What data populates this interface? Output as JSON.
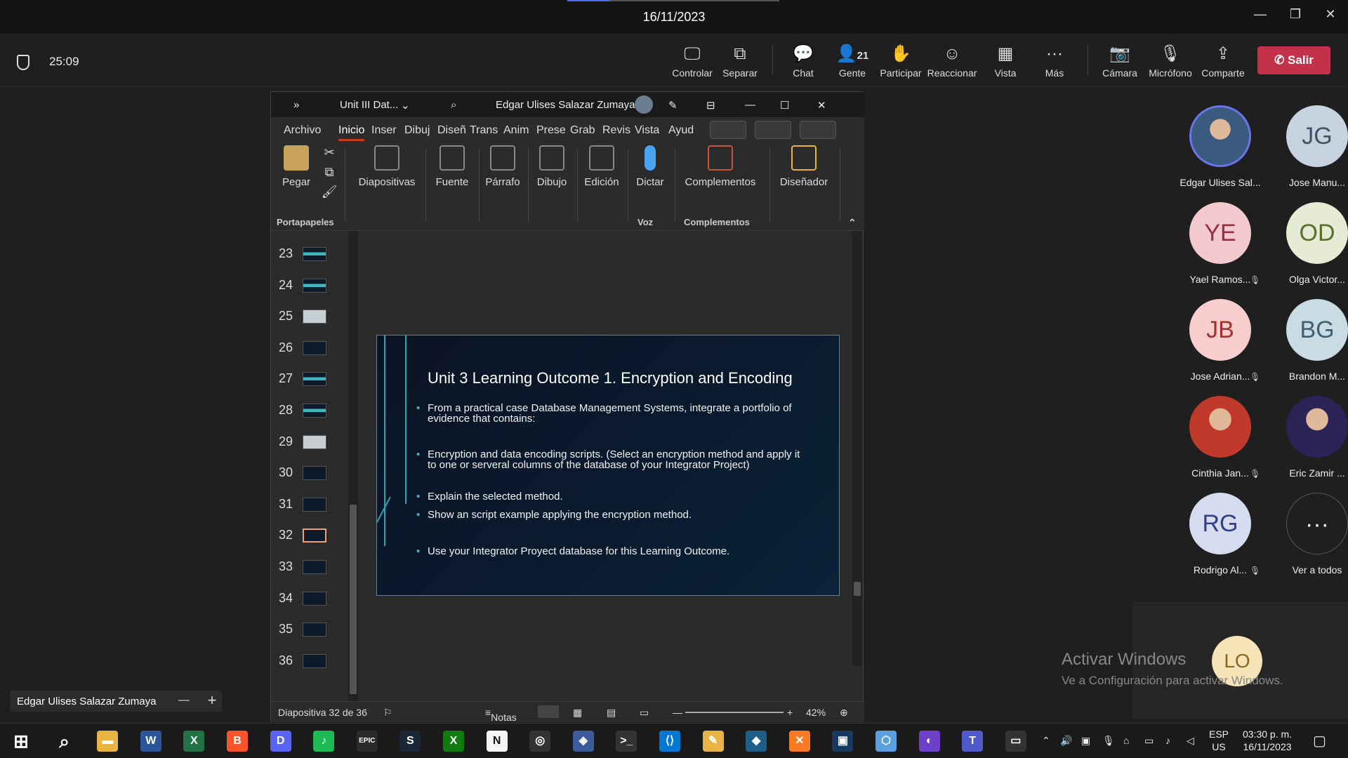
{
  "titlebar": {
    "date": "16/11/2023"
  },
  "meeting": {
    "timer": "25:09",
    "toolbar": [
      {
        "id": "controlar",
        "label": "Controlar",
        "icon": "control-icon",
        "glyph": "🖵"
      },
      {
        "id": "separar",
        "label": "Separar",
        "icon": "popout-icon",
        "glyph": "⧉"
      },
      {
        "id": "chat",
        "label": "Chat",
        "icon": "chat-icon",
        "glyph": "💬"
      },
      {
        "id": "gente",
        "label": "Gente",
        "icon": "people-icon",
        "glyph": "👤",
        "count": "21"
      },
      {
        "id": "participar",
        "label": "Participar",
        "icon": "raise-hand-icon",
        "glyph": "✋"
      },
      {
        "id": "reaccionar",
        "label": "Reaccionar",
        "icon": "react-icon",
        "glyph": "☺"
      },
      {
        "id": "vista",
        "label": "Vista",
        "icon": "view-icon",
        "glyph": "▦"
      },
      {
        "id": "mas",
        "label": "Más",
        "icon": "more-icon",
        "glyph": "···"
      },
      {
        "id": "camara",
        "label": "Cámara",
        "icon": "camera-off-icon",
        "glyph": "📷"
      },
      {
        "id": "microfono",
        "label": "Micrófono",
        "icon": "mic-off-icon",
        "glyph": "🎙"
      },
      {
        "id": "comparte",
        "label": "Comparte",
        "icon": "share-icon",
        "glyph": "⇪"
      }
    ],
    "leave_label": "Salir"
  },
  "ppt": {
    "file_name": "Unit III Dat...",
    "user_name": "Edgar Ulises Salazar Zumaya",
    "tabs": [
      "Archivo",
      "Inicio",
      "Inser",
      "Dibuj",
      "Diseñ",
      "Trans",
      "Anim",
      "Prese",
      "Grab",
      "Revis",
      "Vista",
      "Ayud"
    ],
    "active_tab": "Inicio",
    "ribbon": {
      "pegar": "Pegar",
      "diapositivas": "Diapositivas",
      "fuente": "Fuente",
      "parrafo": "Párrafo",
      "dibujo": "Dibujo",
      "edicion": "Edición",
      "dictar": "Dictar",
      "complementos": "Complementos",
      "disenador": "Diseñador",
      "group_portapapeles": "Portapapeles",
      "group_voz": "Voz",
      "group_complementos": "Complementos"
    },
    "thumbnails": [
      {
        "num": "23",
        "style": "teal"
      },
      {
        "num": "24",
        "style": "teal"
      },
      {
        "num": "25",
        "style": "light"
      },
      {
        "num": "26",
        "style": "dark"
      },
      {
        "num": "27",
        "style": "teal"
      },
      {
        "num": "28",
        "style": "teal"
      },
      {
        "num": "29",
        "style": "light"
      },
      {
        "num": "30",
        "style": "dark"
      },
      {
        "num": "31",
        "style": "dark"
      },
      {
        "num": "32",
        "style": "sel"
      },
      {
        "num": "33",
        "style": "dark"
      },
      {
        "num": "34",
        "style": "dark"
      },
      {
        "num": "35",
        "style": "dark"
      },
      {
        "num": "36",
        "style": "dark"
      }
    ],
    "slide": {
      "title": "Unit 3 Learning Outcome 1. Encryption and Encoding",
      "bullets": [
        "From a practical case Database Management Systems, integrate a portfolio of evidence that contains:",
        "Encryption and data encoding scripts. (Select an encryption method and apply it to one or serveral columns of the database of your Integrator Project)",
        "Explain the selected method.",
        "Show an script example applying the encryption method.",
        "Use your Integrator Proyect database for this Learning Outcome."
      ]
    },
    "status": {
      "slide_count": "Diapositiva 32 de 36",
      "notes": "Notas",
      "zoom": "42%"
    }
  },
  "participants": [
    {
      "name": "Edgar Ulises Sal...",
      "initials": "",
      "photo": true,
      "bg": "#3a5a80",
      "muted": false
    },
    {
      "name": "Jose Manu...",
      "initials": "JG",
      "bg": "#c7d4e0",
      "fg": "#3e5566",
      "muted": true
    },
    {
      "name": "Yael Ramos...",
      "initials": "YE",
      "bg": "#f2c9cf",
      "fg": "#9b2f3f",
      "muted": true
    },
    {
      "name": "Olga Victor...",
      "initials": "OD",
      "bg": "#e5ecd3",
      "fg": "#5b6d2c",
      "muted": true
    },
    {
      "name": "Jose Adrian...",
      "initials": "JB",
      "bg": "#f7cdcd",
      "fg": "#a0332f",
      "muted": true
    },
    {
      "name": "Brandon M...",
      "initials": "BG",
      "bg": "#c9dbe3",
      "fg": "#3e6070",
      "muted": true
    },
    {
      "name": "Cinthia Jan...",
      "initials": "",
      "photo": true,
      "bg": "#c0392b",
      "muted": true
    },
    {
      "name": "Eric Zamir ...",
      "initials": "",
      "photo": true,
      "bg": "#2a2355",
      "muted": true
    },
    {
      "name": "Rodrigo Al...",
      "initials": "RG",
      "bg": "#d5dcef",
      "fg": "#34408a",
      "muted": true
    },
    {
      "name": "Ver a todos",
      "initials": "···",
      "overflow": true,
      "muted": false
    }
  ],
  "self_view": {
    "initials": "LO",
    "bg": "#f6e3b8",
    "fg": "#8a6820"
  },
  "watermark": {
    "line1": "Activar Windows",
    "line2": "Ve a Configuración para activar Windows."
  },
  "presenter_chip": {
    "name": "Edgar Ulises Salazar Zumaya",
    "minus": "—",
    "plus": "+"
  },
  "taskbar": {
    "apps": [
      {
        "name": "start-icon",
        "label": "⊞",
        "bg": "transparent"
      },
      {
        "name": "search-icon",
        "label": "⌕",
        "bg": "transparent"
      },
      {
        "name": "file-explorer-icon",
        "label": "▬",
        "bg": "#e8b443"
      },
      {
        "name": "word-icon",
        "label": "W",
        "bg": "#2b579a"
      },
      {
        "name": "excel-icon",
        "label": "X",
        "bg": "#217346"
      },
      {
        "name": "brave-icon",
        "label": "B",
        "bg": "#fb542b"
      },
      {
        "name": "discord-icon",
        "label": "D",
        "bg": "#5865f2"
      },
      {
        "name": "spotify-icon",
        "label": "♪",
        "bg": "#1db954"
      },
      {
        "name": "epic-games-icon",
        "label": "EPIC",
        "bg": "#2a2a2a"
      },
      {
        "name": "steam-icon",
        "label": "S",
        "bg": "#1b2838"
      },
      {
        "name": "xbox-icon",
        "label": "X",
        "bg": "#107c10"
      },
      {
        "name": "notion-icon",
        "label": "N",
        "bg": "#f5f5f5"
      },
      {
        "name": "obs-icon",
        "label": "◎",
        "bg": "#333"
      },
      {
        "name": "app-icon",
        "label": "◈",
        "bg": "#3d5a9a"
      },
      {
        "name": "terminal-icon",
        "label": ">_",
        "bg": "#333"
      },
      {
        "name": "vscode-icon",
        "label": "⟨⟩",
        "bg": "#0078d4"
      },
      {
        "name": "paint-icon",
        "label": "✎",
        "bg": "#e8b443"
      },
      {
        "name": "mysql-icon",
        "label": "◆",
        "bg": "#1e5f8a"
      },
      {
        "name": "xampp-icon",
        "label": "✕",
        "bg": "#fb7a24"
      },
      {
        "name": "virtualbox-icon",
        "label": "▣",
        "bg": "#183a61"
      },
      {
        "name": "3d-icon",
        "label": "⬡",
        "bg": "#5aa0e0"
      },
      {
        "name": "github-icon",
        "label": "◐",
        "bg": "#6e40c9"
      },
      {
        "name": "teams-icon",
        "label": "T",
        "bg": "#5059c9"
      },
      {
        "name": "cmd-icon",
        "label": "▭",
        "bg": "#333"
      }
    ],
    "lang": "ESP",
    "region": "US",
    "time": "03:30 p. m.",
    "date": "16/11/2023"
  }
}
